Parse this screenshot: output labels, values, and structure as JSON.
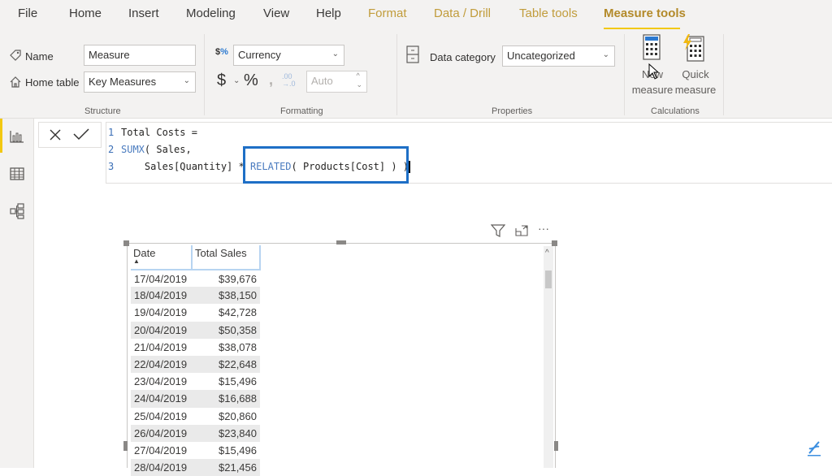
{
  "menu": {
    "items": [
      {
        "label": "File"
      },
      {
        "label": "Home"
      },
      {
        "label": "Insert"
      },
      {
        "label": "Modeling"
      },
      {
        "label": "View"
      },
      {
        "label": "Help"
      },
      {
        "label": "Format"
      },
      {
        "label": "Data / Drill"
      },
      {
        "label": "Table tools"
      },
      {
        "label": "Measure tools"
      }
    ],
    "active": "Measure tools"
  },
  "ribbon": {
    "structure": {
      "group_label": "Structure",
      "name_label": "Name",
      "name_value": "Measure",
      "home_table_label": "Home table",
      "home_table_value": "Key Measures"
    },
    "formatting": {
      "group_label": "Formatting",
      "format_value": "Currency",
      "currency_symbol": "$",
      "percent_symbol": "%",
      "comma_symbol": "❜",
      "decimal_symbol": ".00→.0",
      "decimals_value": "Auto"
    },
    "properties": {
      "group_label": "Properties",
      "data_category_label": "Data category",
      "data_category_value": "Uncategorized"
    },
    "calculations": {
      "group_label": "Calculations",
      "new_measure_line1": "New",
      "new_measure_line2": "measure",
      "quick_measure_line1": "Quick",
      "quick_measure_line2": "measure"
    }
  },
  "formula": {
    "lines": [
      {
        "num": "1",
        "pre": "Total Costs =",
        "kw": "",
        "post": ""
      },
      {
        "num": "2",
        "pre": "",
        "kw": "SUMX",
        "post": "( Sales,"
      },
      {
        "num": "3",
        "pre": "    Sales[Quantity] * ",
        "kw": "RELATED",
        "post": "( Products[Cost] ) )"
      }
    ]
  },
  "table": {
    "columns": [
      "Date",
      "Total Sales"
    ],
    "rows": [
      [
        "17/04/2019",
        "$39,676"
      ],
      [
        "18/04/2019",
        "$38,150"
      ],
      [
        "19/04/2019",
        "$42,728"
      ],
      [
        "20/04/2019",
        "$50,358"
      ],
      [
        "21/04/2019",
        "$38,078"
      ],
      [
        "22/04/2019",
        "$22,648"
      ],
      [
        "23/04/2019",
        "$15,496"
      ],
      [
        "24/04/2019",
        "$16,688"
      ],
      [
        "25/04/2019",
        "$20,860"
      ],
      [
        "26/04/2019",
        "$23,840"
      ],
      [
        "27/04/2019",
        "$15,496"
      ],
      [
        "28/04/2019",
        "$21,456"
      ]
    ]
  },
  "visual_toolbar": {
    "more": "···"
  },
  "colors": {
    "accent": "#f2c811",
    "highlight_box": "#1e6fc6",
    "context_tab": "#c19c3b"
  }
}
